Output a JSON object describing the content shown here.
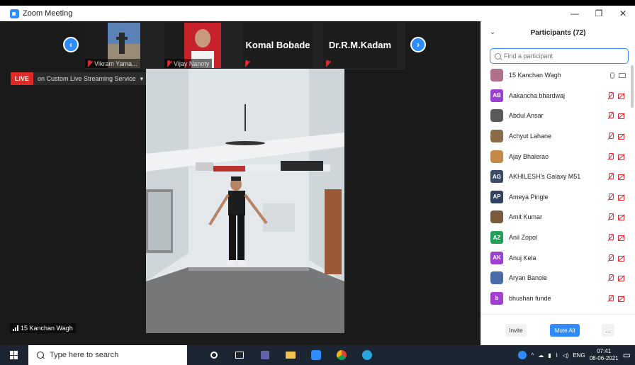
{
  "window": {
    "title": "Zoom Meeting",
    "controls": [
      "—",
      "❐",
      "✕"
    ]
  },
  "tiles": [
    {
      "name": "Vikram Yama...",
      "type": "photo"
    },
    {
      "name": "Vijay Nanoty",
      "type": "photo"
    },
    {
      "name": "Komal Bobade",
      "type": "name"
    },
    {
      "name": "Dr.R.M.Kadam",
      "type": "name"
    }
  ],
  "stream": {
    "live_label": "LIVE",
    "service_label": "on Custom Live Streaming Service",
    "caret": "▾"
  },
  "self_view": {
    "name": "15 Kanchan Wagh"
  },
  "participants_panel": {
    "title": "Participants (72)",
    "collapse_icon": "chevron-down-icon",
    "search_placeholder": "Find a participant",
    "participants": [
      {
        "name": "15 Kanchan Wagh",
        "avatar_text": "",
        "avatar_color": "#b0708a",
        "photo": true,
        "muted": false
      },
      {
        "name": "Aakancha bhardwaj",
        "avatar_text": "AB",
        "avatar_color": "#9c3fd3",
        "photo": false,
        "muted": true
      },
      {
        "name": "Abdul Ansar",
        "avatar_text": "",
        "avatar_color": "#5a5a5a",
        "photo": true,
        "muted": true
      },
      {
        "name": "Achyut Lahane",
        "avatar_text": "",
        "avatar_color": "#8a6b4c",
        "photo": true,
        "muted": true
      },
      {
        "name": "Ajay Bhalerao",
        "avatar_text": "",
        "avatar_color": "#c48a4a",
        "photo": true,
        "muted": true
      },
      {
        "name": "AKHILESH's Galaxy M51",
        "avatar_text": "AG",
        "avatar_color": "#3c4a63",
        "photo": false,
        "muted": true
      },
      {
        "name": "Ameya Pingle",
        "avatar_text": "AP",
        "avatar_color": "#2f4260",
        "photo": false,
        "muted": true
      },
      {
        "name": "Amit Kumar",
        "avatar_text": "",
        "avatar_color": "#7a5a3a",
        "photo": true,
        "muted": true
      },
      {
        "name": "Anil Zopol",
        "avatar_text": "AZ",
        "avatar_color": "#24a05a",
        "photo": false,
        "muted": true
      },
      {
        "name": "Anuj Kela",
        "avatar_text": "AK",
        "avatar_color": "#9c3fd3",
        "photo": false,
        "muted": true
      },
      {
        "name": "Aryan Banole",
        "avatar_text": "",
        "avatar_color": "#4a6aa8",
        "photo": true,
        "muted": true
      },
      {
        "name": "bhushan funde",
        "avatar_text": "b",
        "avatar_color": "#a53fd3",
        "photo": false,
        "muted": true
      }
    ],
    "invite_label": "Invite",
    "mute_all_label": "Mute All",
    "more_label": "..."
  },
  "taskbar": {
    "search_placeholder": "Type here to search",
    "tray_language": "ENG",
    "time": "07:41",
    "date": "08-06-2021"
  }
}
